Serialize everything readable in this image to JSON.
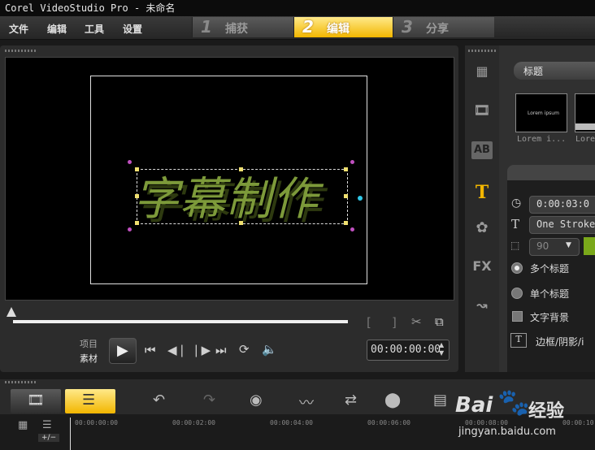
{
  "window": {
    "title": "Corel VideoStudio Pro - 未命名"
  },
  "menu": [
    "文件",
    "编辑",
    "工具",
    "设置"
  ],
  "steps": [
    {
      "num": "1",
      "label": "捕获"
    },
    {
      "num": "2",
      "label": "编辑"
    },
    {
      "num": "3",
      "label": "分享"
    }
  ],
  "preview": {
    "title_text": "字幕制作",
    "mode_project": "项目",
    "mode_clip": "素材",
    "timecode": "00:00:00:00"
  },
  "library": {
    "category": "标题",
    "thumbs": [
      {
        "caption": "Lorem i...",
        "preview": "Lorem ipsum"
      },
      {
        "caption": "Lore"
      }
    ]
  },
  "options": {
    "duration": "0:00:03:0",
    "font": "One Stroke",
    "angle": "90",
    "multi_title": "多个标题",
    "single_title": "单个标题",
    "text_bg": "文字背景",
    "border_shadow": "边框/阴影/i"
  },
  "timeline": {
    "ticks": [
      "00:00:00:00",
      "00:00:02:00",
      "00:00:04:00",
      "00:00:06:00",
      "00:00:08:00",
      "00:00:10"
    ],
    "zoom_control": "+/−"
  },
  "watermark": {
    "brand": "Bai",
    "brand2": "经验",
    "url": "jingyan.baidu.com"
  },
  "colors": {
    "accent": "#f2b600",
    "title_green": "#7d9a3a",
    "color_swatch": "#7aa81a"
  }
}
